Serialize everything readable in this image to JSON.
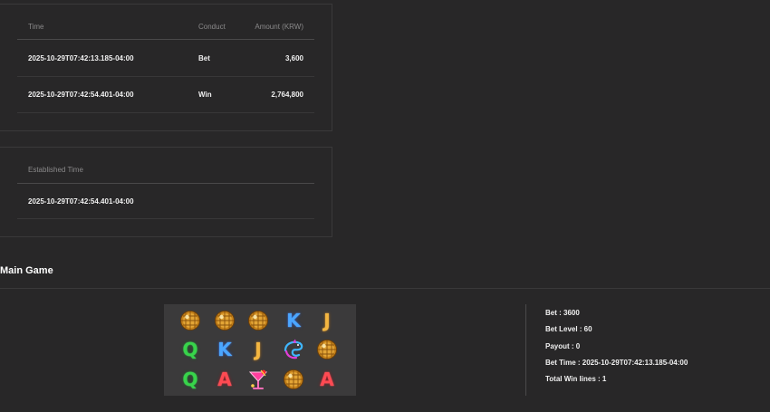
{
  "transactions": {
    "headers": {
      "time": "Time",
      "conduct": "Conduct",
      "amount": "Amount (KRW)"
    },
    "rows": [
      {
        "time": "2025-10-29T07:42:13.185-04:00",
        "conduct": "Bet",
        "amount": "3,600"
      },
      {
        "time": "2025-10-29T07:42:54.401-04:00",
        "conduct": "Win",
        "amount": "2,764,800"
      }
    ]
  },
  "established": {
    "header": "Established Time",
    "value": "2025-10-29T07:42:54.401-04:00"
  },
  "main_game": {
    "title": "Main Game",
    "reels": [
      [
        "disco-ball",
        "disco-ball",
        "disco-ball",
        "K",
        "J"
      ],
      [
        "Q",
        "K",
        "J",
        "dolphin",
        "disco-ball"
      ],
      [
        "Q",
        "A",
        "cocktail",
        "disco-ball",
        "A"
      ]
    ],
    "info": [
      "Bet : 3600",
      "Bet Level : 60",
      "Payout : 0",
      "Bet Time : 2025-10-29T07:42:13.185-04:00",
      "Total Win lines : 1"
    ]
  },
  "colors": {
    "background": "#282728",
    "border": "#3a393a",
    "reel_bg": "#3b3a3b",
    "q_green": "#37d44a",
    "k_blue": "#4aa6ff",
    "j_gold": "#f4b640",
    "a_red": "#ff4a52"
  }
}
